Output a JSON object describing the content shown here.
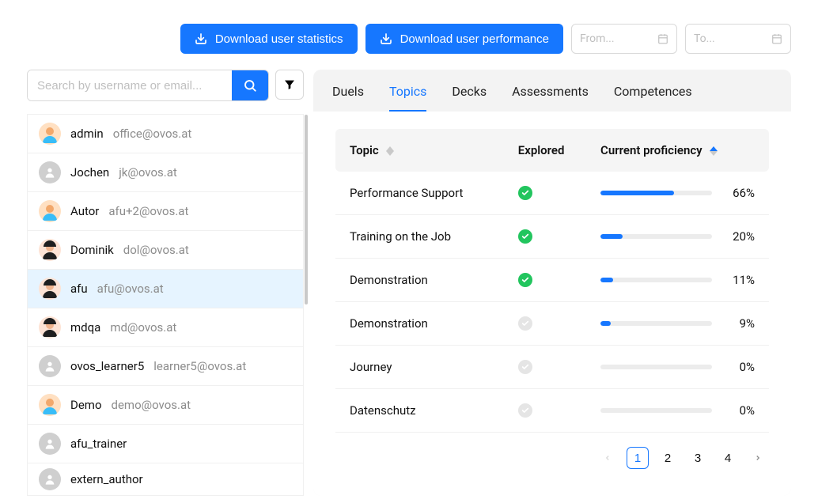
{
  "toolbar": {
    "download_stats": "Download user statistics",
    "download_perf": "Download user performance",
    "from_placeholder": "From...",
    "to_placeholder": "To..."
  },
  "search": {
    "placeholder": "Search by username or email..."
  },
  "users": [
    {
      "name": "admin",
      "email": "office@ovos.at",
      "avatar": "peach",
      "selected": false
    },
    {
      "name": "Jochen",
      "email": "jk@ovos.at",
      "avatar": "gray",
      "selected": false
    },
    {
      "name": "Autor",
      "email": "afu+2@ovos.at",
      "avatar": "peach",
      "selected": false
    },
    {
      "name": "Dominik",
      "email": "dol@ovos.at",
      "avatar": "dark",
      "selected": false
    },
    {
      "name": "afu",
      "email": "afu@ovos.at",
      "avatar": "dark",
      "selected": true
    },
    {
      "name": "mdqa",
      "email": "md@ovos.at",
      "avatar": "dark",
      "selected": false
    },
    {
      "name": "ovos_learner5",
      "email": "learner5@ovos.at",
      "avatar": "gray",
      "selected": false
    },
    {
      "name": "Demo",
      "email": "demo@ovos.at",
      "avatar": "peach",
      "selected": false
    },
    {
      "name": "afu_trainer",
      "email": "",
      "avatar": "gray",
      "selected": false
    },
    {
      "name": "extern_author",
      "email": "",
      "avatar": "gray",
      "selected": false
    }
  ],
  "tabs": [
    {
      "label": "Duels",
      "active": false
    },
    {
      "label": "Topics",
      "active": true
    },
    {
      "label": "Decks",
      "active": false
    },
    {
      "label": "Assessments",
      "active": false
    },
    {
      "label": "Competences",
      "active": false
    }
  ],
  "table": {
    "columns": {
      "topic": "Topic",
      "explored": "Explored",
      "proficiency": "Current proficiency"
    },
    "rows": [
      {
        "topic": "Performance Support",
        "explored": true,
        "proficiency": 66
      },
      {
        "topic": "Training on the Job",
        "explored": true,
        "proficiency": 20
      },
      {
        "topic": "Demonstration",
        "explored": true,
        "proficiency": 11
      },
      {
        "topic": "Demonstration",
        "explored": false,
        "proficiency": 9
      },
      {
        "topic": "Journey",
        "explored": false,
        "proficiency": 0
      },
      {
        "topic": "Datenschutz",
        "explored": false,
        "proficiency": 0
      }
    ]
  },
  "pagination": {
    "pages": [
      1,
      2,
      3,
      4
    ],
    "current": 1
  }
}
